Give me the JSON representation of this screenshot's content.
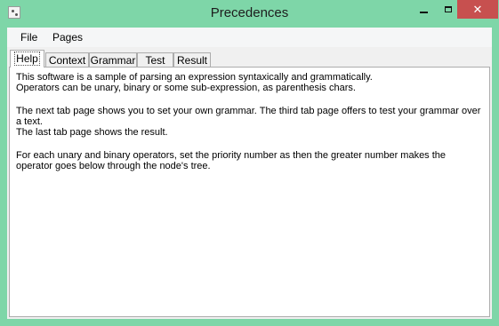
{
  "window": {
    "title": "Precedences",
    "controls": {
      "minimize_icon": "minimize-icon",
      "maximize_icon": "maximize-icon",
      "close_label": "✕"
    }
  },
  "menu": [
    {
      "label": "File"
    },
    {
      "label": "Pages"
    }
  ],
  "tabs": [
    {
      "label": "Help",
      "active": true
    },
    {
      "label": "Context"
    },
    {
      "label": "Grammar"
    },
    {
      "label": "Test"
    },
    {
      "label": "Result"
    }
  ],
  "help": {
    "para1_line1": "This software is a sample of parsing an expression syntaxically and grammatically.",
    "para1_line2": "Operators can be unary, binary or some sub-expression, as parenthesis chars.",
    "para2_line1": "The next tab page shows you to set your own grammar. The third tab page offers to test your grammar over a text.",
    "para2_line2": "The last tab page shows the result.",
    "para3": "For each unary and binary operators, set the priority number as then the greater number makes the operator goes below through the node's tree."
  },
  "colors": {
    "frame": "#7ed6a8",
    "close_button": "#c7504f"
  }
}
